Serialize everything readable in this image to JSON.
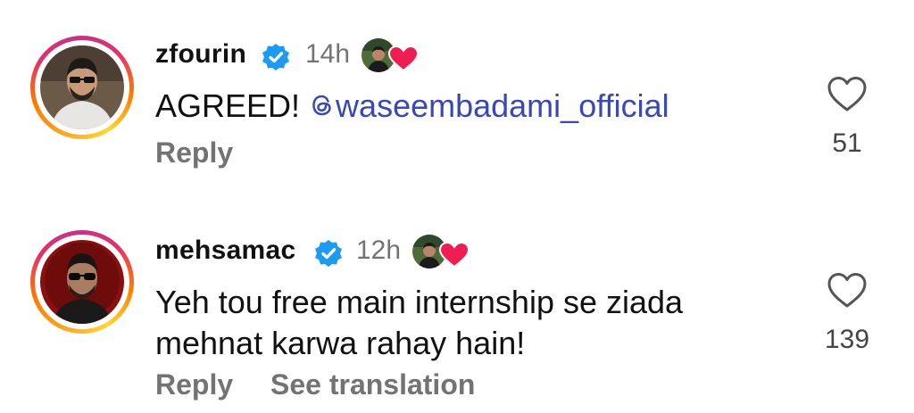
{
  "comments": [
    {
      "username": "zfourin",
      "verified": true,
      "time": "14h",
      "text_prefix": "AGREED! ",
      "mention": "waseembadami_official",
      "likes": "51",
      "reply_label": "Reply",
      "avatar_icon": "user-avatar-sunglasses-white-shirt",
      "liked_by_author_icon": "author-avatar-heart"
    },
    {
      "username": "mehsamac",
      "verified": true,
      "time": "12h",
      "text": "Yeh tou free main internship se ziada mehnat karwa rahay hain!",
      "likes": "139",
      "reply_label": "Reply",
      "translation_label": "See translation",
      "avatar_icon": "user-avatar-sunglasses-red-background",
      "liked_by_author_icon": "author-avatar-heart"
    }
  ],
  "colors": {
    "verified_badge": "#1d9bf0",
    "mention": "#3a48b5",
    "secondary_text": "#737373",
    "heart_red": "#ee1d52"
  }
}
